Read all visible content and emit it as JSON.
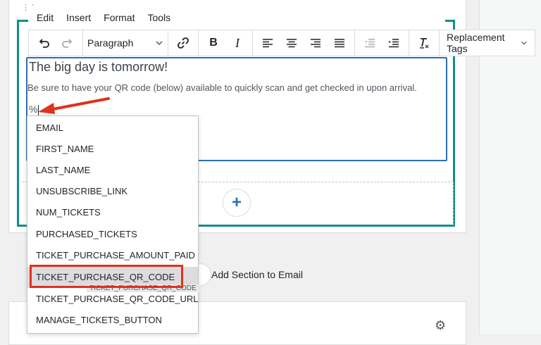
{
  "menubar": {
    "items": [
      "Edit",
      "Insert",
      "Format",
      "Tools"
    ]
  },
  "toolbar": {
    "format_value": "Paragraph",
    "replacement_tags_label": "Replacement Tags"
  },
  "editor": {
    "heading": "The big day is tomorrow!",
    "paragraph": "Be sure to have your QR code (below) available to quickly scan and get checked in upon arrival.",
    "current_text": "%"
  },
  "dropdown": {
    "items": [
      "EMAIL",
      "FIRST_NAME",
      "LAST_NAME",
      "UNSUBSCRIBE_LINK",
      "NUM_TICKETS",
      "PURCHASED_TICKETS",
      "TICKET_PURCHASE_AMOUNT_PAID",
      "TICKET_PURCHASE_QR_CODE",
      "TICKET_PURCHASE_QR_CODE_URL",
      "MANAGE_TICKETS_BUTTON"
    ],
    "highlighted_index": 7,
    "drag_ghost": "TICKET_PURCHASE_QR_CODE"
  },
  "section": {
    "add_section_label": "Add Section to Email"
  },
  "colors": {
    "accent_teal": "#0f8f86",
    "focus_blue": "#2c6fb0",
    "annotation_red": "#e0311d"
  }
}
